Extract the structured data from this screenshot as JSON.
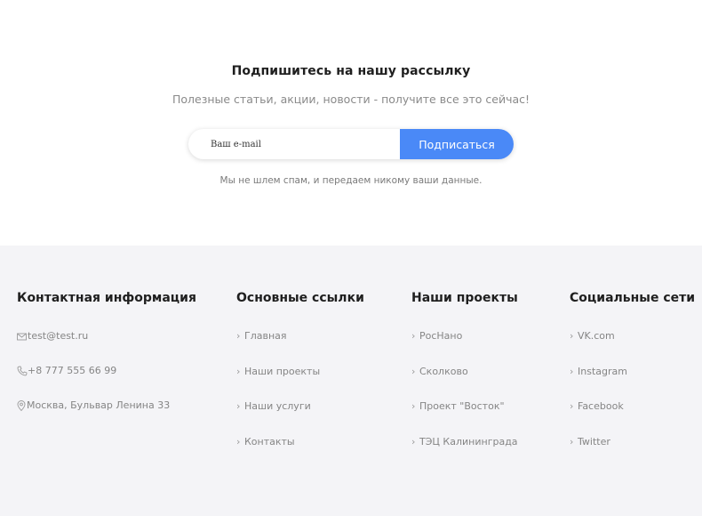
{
  "newsletter": {
    "title": "Подпишитесь на нашу рассылку",
    "subtitle": "Полезные статьи, акции, новости - получите все это сейчас!",
    "email_placeholder": "Ваш e-mail",
    "subscribe_label": "Подписаться",
    "note": "Мы не шлем спам, и передаем никому ваши данные.",
    "button_color": "#4a89f7"
  },
  "footer": {
    "background": "#f4f4f7",
    "contacts": {
      "title": "Контактная информация",
      "email": "test@test.ru",
      "phone": "+8 777 555 66 99",
      "address": "Москва, Бульвар Ленина 33",
      "icons": [
        "envelope-icon",
        "phone-icon",
        "location-pin-icon"
      ]
    },
    "links": {
      "title": "Основные ссылки",
      "items": [
        "Главная",
        "Наши проекты",
        "Наши услуги",
        "Контакты"
      ]
    },
    "projects": {
      "title": "Наши проекты",
      "items": [
        "РосНано",
        "Сколково",
        "Проект \"Восток\"",
        "ТЭЦ Калининграда"
      ]
    },
    "social": {
      "title": "Социальные сети",
      "items": [
        "VK.com",
        "Instagram",
        "Facebook",
        "Twitter"
      ]
    }
  }
}
